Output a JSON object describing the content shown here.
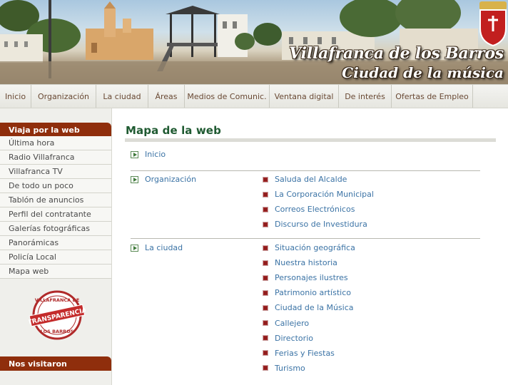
{
  "banner": {
    "title_line1": "Villafranca de los Barros",
    "title_line2": "Ciudad de la música"
  },
  "nav": {
    "items": [
      {
        "label": "Inicio"
      },
      {
        "label": "Organización"
      },
      {
        "label": "La ciudad"
      },
      {
        "label": "Áreas"
      },
      {
        "label": "Medios de Comunic."
      },
      {
        "label": "Ventana digital"
      },
      {
        "label": "De interés"
      },
      {
        "label": "Ofertas de Empleo"
      }
    ]
  },
  "sidebar": {
    "heading": "Viaja por la web",
    "items": [
      {
        "label": "Última hora"
      },
      {
        "label": "Radio Villafranca"
      },
      {
        "label": "Villafranca TV"
      },
      {
        "label": "De todo un poco"
      },
      {
        "label": "Tablón de anuncios"
      },
      {
        "label": "Perfil del contratante"
      },
      {
        "label": "Galerías fotográficas"
      },
      {
        "label": "Panorámicas"
      },
      {
        "label": "Policía Local"
      },
      {
        "label": "Mapa web"
      }
    ],
    "seal": {
      "top": "VILLAFRANCA DE",
      "center": "TRANSPARENCIA",
      "bottom": "LOS BARROS"
    },
    "footer_heading": "Nos visitaron"
  },
  "main": {
    "title": "Mapa de la web",
    "sections": [
      {
        "label": "Inicio",
        "links": []
      },
      {
        "label": "Organización",
        "links": [
          {
            "label": "Saluda del Alcalde"
          },
          {
            "label": "La Corporación Municipal"
          },
          {
            "label": "Correos Electrónicos"
          },
          {
            "label": "Discurso de Investidura"
          }
        ]
      },
      {
        "label": "La ciudad",
        "links": [
          {
            "label": "Situación geográfica"
          },
          {
            "label": "Nuestra historia"
          },
          {
            "label": "Personajes ilustres"
          },
          {
            "label": "Patrimonio artístico"
          },
          {
            "label": "Ciudad de la Música"
          },
          {
            "label": "Callejero"
          },
          {
            "label": "Directorio"
          },
          {
            "label": "Ferias y Fiestas"
          },
          {
            "label": "Turismo"
          }
        ]
      }
    ]
  },
  "colors": {
    "nav_text": "#6a4a35",
    "sidebar_heading_bg": "#8f2e0c",
    "title_green": "#1f5a31",
    "link_blue": "#3b73a5",
    "bullet_red": "#8f1c1c"
  }
}
